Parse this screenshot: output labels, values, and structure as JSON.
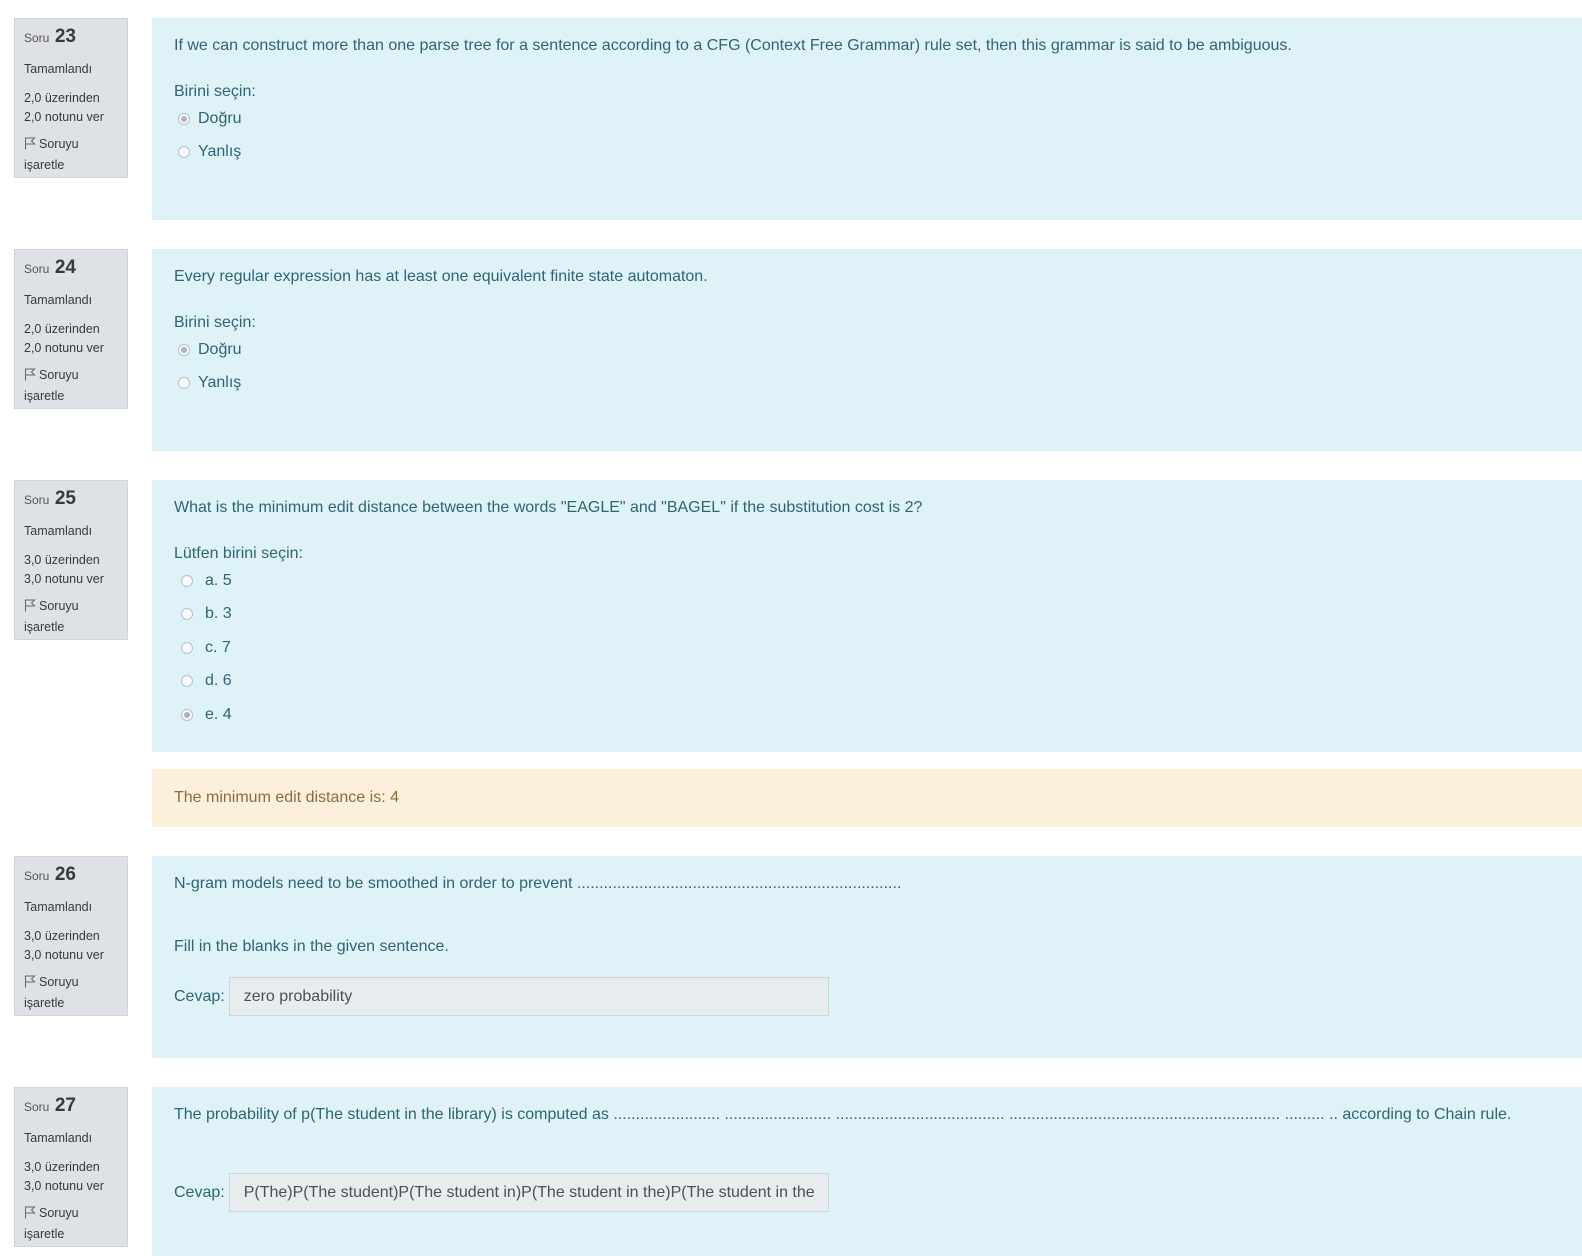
{
  "questions": [
    {
      "soru_label": "Soru",
      "number": "23",
      "state": "Tamamlandı",
      "grade_line1": "2,0 üzerinden",
      "grade_line2": "2,0 notunu ver",
      "flag_line1": "Soruyu",
      "flag_line2": "işaretle",
      "text": "If we can construct more than one parse tree for a sentence according to a CFG (Context Free Grammar) rule set, then this grammar is said to be ambiguous.",
      "prompt": "Birini seçin:",
      "options": [
        {
          "label": "Doğru",
          "selected": true
        },
        {
          "label": "Yanlış",
          "selected": false
        }
      ]
    },
    {
      "soru_label": "Soru",
      "number": "24",
      "state": "Tamamlandı",
      "grade_line1": "2,0 üzerinden",
      "grade_line2": "2,0 notunu ver",
      "flag_line1": "Soruyu",
      "flag_line2": "işaretle",
      "text": "Every regular expression has at least one equivalent finite state automaton.",
      "prompt": "Birini seçin:",
      "options": [
        {
          "label": "Doğru",
          "selected": true
        },
        {
          "label": "Yanlış",
          "selected": false
        }
      ]
    },
    {
      "soru_label": "Soru",
      "number": "25",
      "state": "Tamamlandı",
      "grade_line1": "3,0 üzerinden",
      "grade_line2": "3,0 notunu ver",
      "flag_line1": "Soruyu",
      "flag_line2": "işaretle",
      "text": "What is the minimum edit distance between the words \"EAGLE\" and \"BAGEL\" if the substitution cost is 2?",
      "prompt": "Lütfen birini seçin:",
      "options": [
        {
          "label": "a. 5",
          "selected": false
        },
        {
          "label": "b. 3",
          "selected": false
        },
        {
          "label": "c. 7",
          "selected": false
        },
        {
          "label": "d. 6",
          "selected": false
        },
        {
          "label": "e. 4",
          "selected": true
        }
      ],
      "feedback": "The minimum edit distance is: 4"
    },
    {
      "soru_label": "Soru",
      "number": "26",
      "state": "Tamamlandı",
      "grade_line1": "3,0 üzerinden",
      "grade_line2": "3,0 notunu ver",
      "flag_line1": "Soruyu",
      "flag_line2": "işaretle",
      "text": "N-gram models need to be smoothed in order to prevent .........................................................................",
      "instruction": "Fill in the blanks in the given sentence.",
      "answer_label": "Cevap:",
      "answer_value": "zero probability"
    },
    {
      "soru_label": "Soru",
      "number": "27",
      "state": "Tamamlandı",
      "grade_line1": "3,0 üzerinden",
      "grade_line2": "3,0 notunu ver",
      "flag_line1": "Soruyu",
      "flag_line2": "işaretle",
      "text": "The probability of p(The student in the library) is computed as  ........................ ........................ ...................................... ............................................................. ......... ..  according to Chain rule.",
      "answer_label": "Cevap:",
      "answer_value": "P(The)P(The student)P(The student in)P(The student in the)P(The student in the"
    }
  ]
}
